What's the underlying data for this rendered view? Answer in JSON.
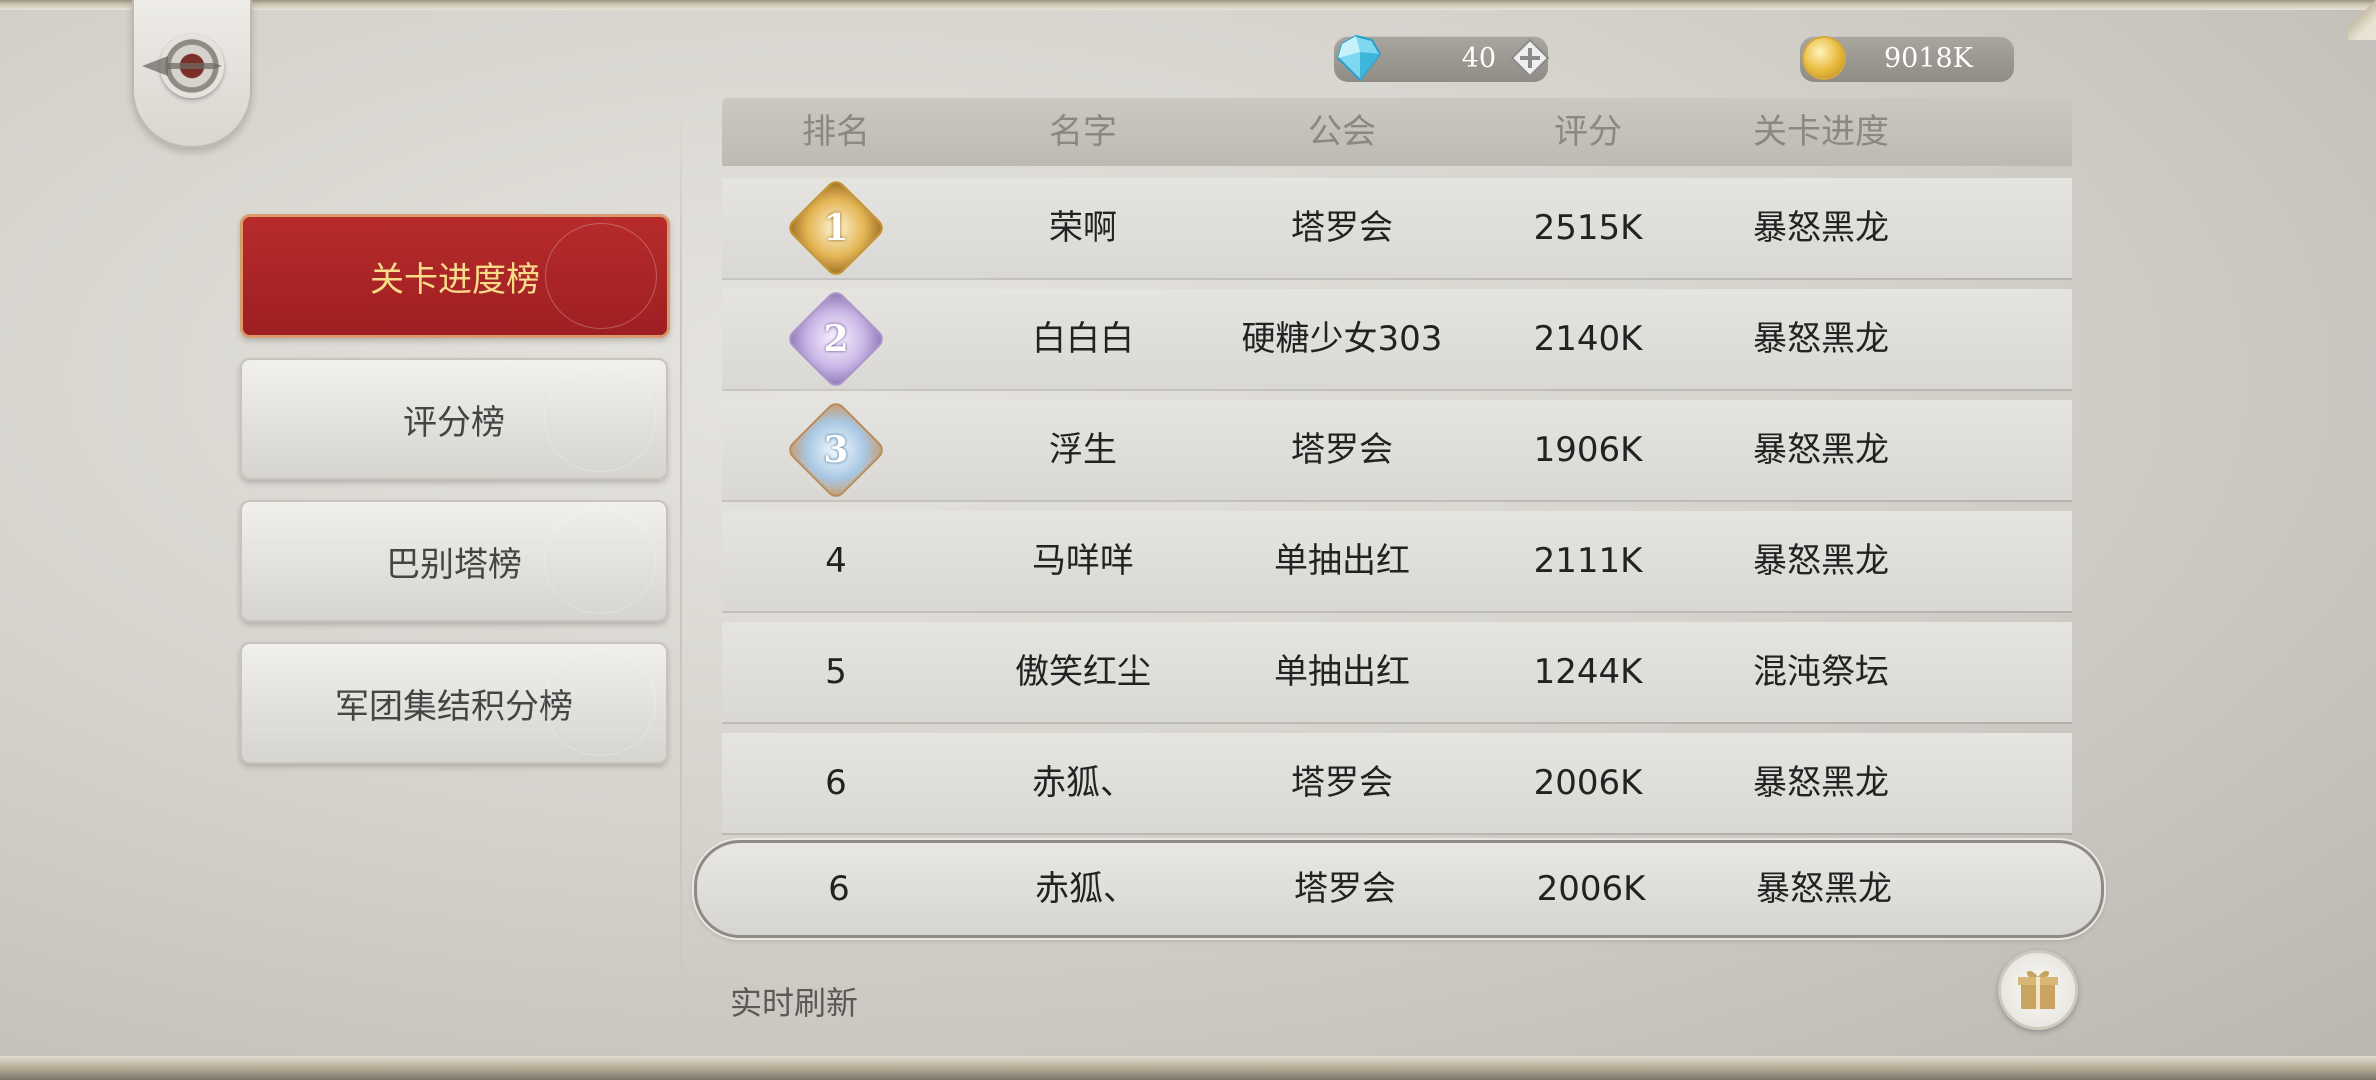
{
  "currency": {
    "gems": "40",
    "gold": "9018K"
  },
  "tabs": [
    {
      "label": "关卡进度榜",
      "active": true
    },
    {
      "label": "评分榜",
      "active": false
    },
    {
      "label": "巴别塔榜",
      "active": false
    },
    {
      "label": "军团集结积分榜",
      "active": false
    }
  ],
  "table": {
    "headers": [
      "排名",
      "名字",
      "公会",
      "评分",
      "关卡进度"
    ],
    "rows": [
      {
        "rank": "1",
        "name": "荣啊",
        "guild": "塔罗会",
        "score": "2515K",
        "progress": "暴怒黑龙"
      },
      {
        "rank": "2",
        "name": "白白白",
        "guild": "硬糖少女303",
        "score": "2140K",
        "progress": "暴怒黑龙"
      },
      {
        "rank": "3",
        "name": "浮生",
        "guild": "塔罗会",
        "score": "1906K",
        "progress": "暴怒黑龙"
      },
      {
        "rank": "4",
        "name": "马咩咩",
        "guild": "单抽出红",
        "score": "2111K",
        "progress": "暴怒黑龙"
      },
      {
        "rank": "5",
        "name": "傲笑红尘",
        "guild": "单抽出红",
        "score": "1244K",
        "progress": "混沌祭坛"
      },
      {
        "rank": "6",
        "name": "赤狐、",
        "guild": "塔罗会",
        "score": "2006K",
        "progress": "暴怒黑龙"
      }
    ],
    "self": {
      "rank": "6",
      "name": "赤狐、",
      "guild": "塔罗会",
      "score": "2006K",
      "progress": "暴怒黑龙"
    }
  },
  "footer": {
    "refresh_text": "实时刷新"
  },
  "colors": {
    "active_tab": "#a82326",
    "active_tab_text": "#f8dc8a",
    "gold_badge": "#e0a53a",
    "silver_badge": "#b9a6d8",
    "bronze_badge": "#8fb2d6"
  },
  "icons": [
    "back-emblem-icon",
    "diamond-gem-icon",
    "plus-icon",
    "gold-coin-icon",
    "gift-icon"
  ]
}
